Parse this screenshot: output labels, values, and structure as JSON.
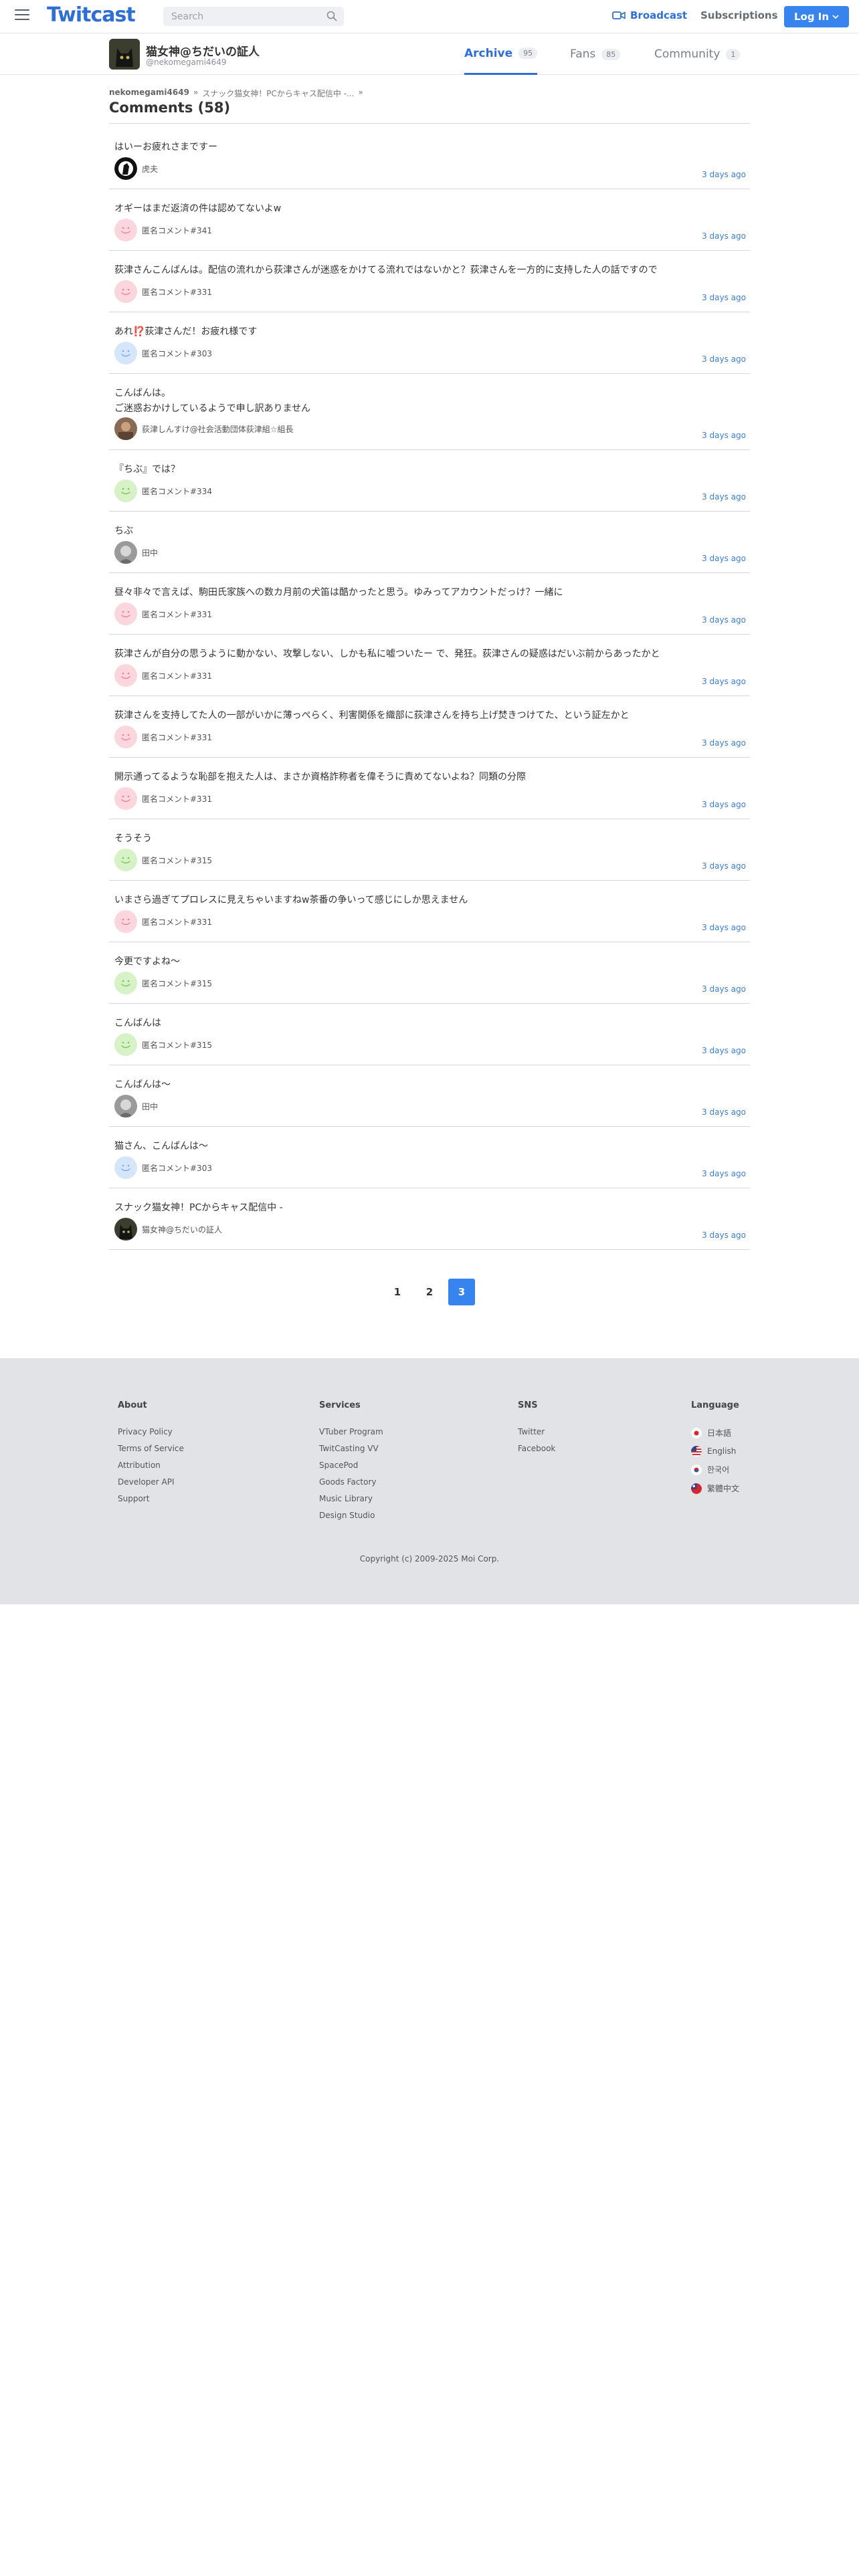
{
  "header": {
    "logo": "Twitcast",
    "search_placeholder": "Search",
    "broadcast_label": "Broadcast",
    "subscriptions_label": "Subscriptions",
    "login_label": "Log In"
  },
  "profile": {
    "name": "猫女神@ちだいの証人",
    "screen_id": "@nekomegami4649",
    "tabs": [
      {
        "label": "Archive",
        "count": "95"
      },
      {
        "label": "Fans",
        "count": "85"
      },
      {
        "label": "Community",
        "count": "1"
      }
    ]
  },
  "breadcrumb": {
    "user": "nekomegami4649",
    "movie": "スナック猫女神！PCからキャス配信中 -..."
  },
  "page_title": "Comments (58)",
  "comments": [
    {
      "text": "はいーお疲れさまですー",
      "author": "虎夫",
      "avatar": "photo-bw",
      "time": "3 days ago"
    },
    {
      "text": "オギーはまだ返済の件は認めてないよw",
      "author": "匿名コメント#341",
      "avatar": "pink",
      "time": "3 days ago"
    },
    {
      "text": "荻津さんこんばんは。配信の流れから荻津さんが迷惑をかけてる流れではないかと？荻津さんを一方的に支持した人の話ですので",
      "author": "匿名コメント#331",
      "avatar": "pink",
      "time": "3 days ago"
    },
    {
      "text": "あれ⁉️荻津さんだ！お疲れ様です",
      "author": "匿名コメント#303",
      "avatar": "blue",
      "time": "3 days ago"
    },
    {
      "text": "こんばんは。",
      "text2": "ご迷惑おかけしているようで申し訳ありません",
      "author": "荻津しんすけ@社会活動団体荻津組☆組長",
      "avatar": "photo-brown",
      "time": "3 days ago"
    },
    {
      "text": "『ちぶ』では？",
      "author": "匿名コメント#334",
      "avatar": "green",
      "time": "3 days ago"
    },
    {
      "text": "ちぶ",
      "author": "田中",
      "avatar": "photo-grey",
      "time": "3 days ago"
    },
    {
      "text": "昼々非々で言えば、駒田氏家族への数カ月前の犬笛は酷かったと思う。ゆみってアカウントだっけ？一緒に",
      "author": "匿名コメント#331",
      "avatar": "pink",
      "time": "3 days ago"
    },
    {
      "text": "荻津さんが自分の思うように動かない、攻撃しない、しかも私に嘘ついたー で、発狂。荻津さんの疑惑はだいぶ前からあったかと",
      "author": "匿名コメント#331",
      "avatar": "pink",
      "time": "3 days ago"
    },
    {
      "text": "荻津さんを支持してた人の一部がいかに薄っぺらく、利害関係を織部に荻津さんを持ち上げ焚きつけてた、という証左かと",
      "author": "匿名コメント#331",
      "avatar": "pink",
      "time": "3 days ago"
    },
    {
      "text": "開示通ってるような恥部を抱えた人は、まさか資格詐称者を偉そうに責めてないよね？同類の分際",
      "author": "匿名コメント#331",
      "avatar": "pink",
      "time": "3 days ago"
    },
    {
      "text": "そうそう",
      "author": "匿名コメント#315",
      "avatar": "green",
      "time": "3 days ago"
    },
    {
      "text": "いまさら過ぎてプロレスに見えちゃいますねw茶番の争いって感じにしか思えません",
      "author": "匿名コメント#331",
      "avatar": "pink",
      "time": "3 days ago"
    },
    {
      "text": "今更ですよね〜",
      "author": "匿名コメント#315",
      "avatar": "green",
      "time": "3 days ago"
    },
    {
      "text": "こんばんは",
      "author": "匿名コメント#315",
      "avatar": "green",
      "time": "3 days ago"
    },
    {
      "text": "こんばんは〜",
      "author": "田中",
      "avatar": "photo-grey",
      "time": "3 days ago"
    },
    {
      "text": "猫さん、こんばんは〜",
      "author": "匿名コメント#303",
      "avatar": "blue",
      "time": "3 days ago"
    },
    {
      "text": "スナック猫女神！PCからキャス配信中 -",
      "author": "猫女神@ちだいの証人",
      "avatar": "photo-cat",
      "time": "3 days ago"
    }
  ],
  "pagination": {
    "pages": [
      "1",
      "2",
      "3"
    ],
    "current": "3"
  },
  "footer": {
    "about": {
      "title": "About",
      "links": [
        "Privacy Policy",
        "Terms of Service",
        "Attribution",
        "Developer API",
        "Support"
      ]
    },
    "services": {
      "title": "Services",
      "links": [
        "VTuber Program",
        "TwitCasting VV",
        "SpacePod",
        "Goods Factory",
        "Music Library",
        "Design Studio"
      ]
    },
    "sns": {
      "title": "SNS",
      "links": [
        "Twitter",
        "Facebook"
      ]
    },
    "language": {
      "title": "Language",
      "items": [
        {
          "label": "日本語",
          "flag": "japan-flag"
        },
        {
          "label": "English",
          "flag": "us-flag"
        },
        {
          "label": "한국어",
          "flag": "korea-flag"
        },
        {
          "label": "繁體中文",
          "flag": "taiwan-flag"
        }
      ]
    },
    "copyright": "Copyright (c) 2009-2025 Moi Corp."
  },
  "colors": {
    "accent": "#2d6fd4",
    "button": "#3884ee",
    "time": "#3a7fd6",
    "footer_bg": "#e1e3e6"
  }
}
